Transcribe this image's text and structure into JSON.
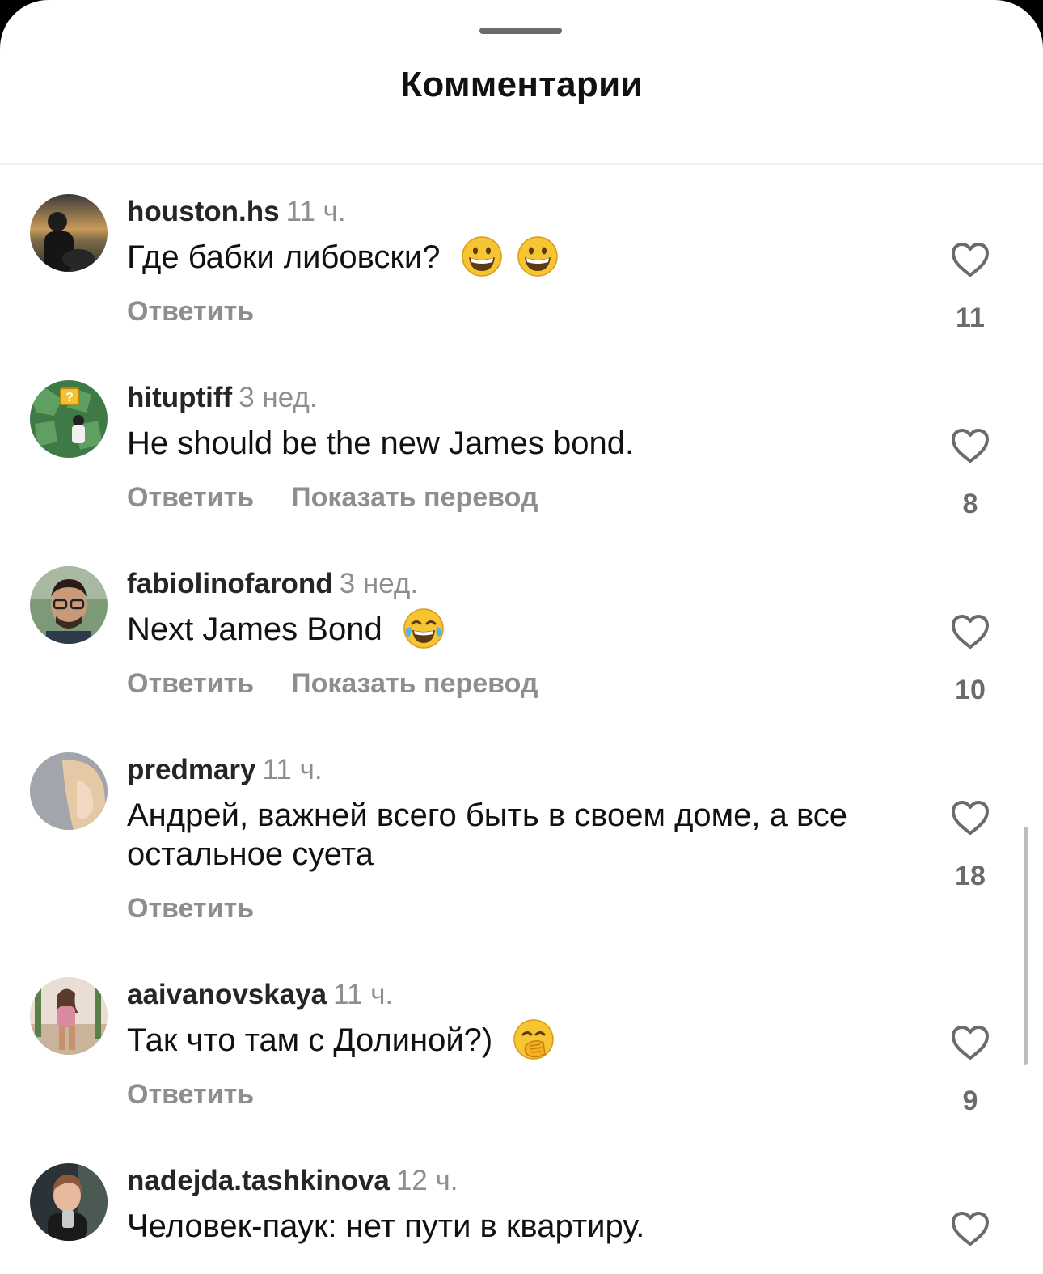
{
  "header": {
    "title": "Комментарии"
  },
  "comments": [
    {
      "username": "houston.hs",
      "time": "11 ч.",
      "text": "Где бабки либовски?",
      "emojis": [
        "grinning-face-emoji",
        "grinning-face-emoji"
      ],
      "reply_label": "Ответить",
      "translate_label": "",
      "like_count": "11"
    },
    {
      "username": "hituptiff",
      "time": "3 нед.",
      "text": "He should be the new James bond.",
      "emojis": [],
      "reply_label": "Ответить",
      "translate_label": "Показать перевод",
      "like_count": "8"
    },
    {
      "username": "fabiolinofarond",
      "time": "3 нед.",
      "text": "Next James Bond",
      "emojis": [
        "tears-of-joy-emoji"
      ],
      "reply_label": "Ответить",
      "translate_label": "Показать перевод",
      "like_count": "10"
    },
    {
      "username": "predmary",
      "time": "11 ч.",
      "text": "Андрей, важней всего быть в своем доме, а все остальное суета",
      "emojis": [],
      "reply_label": "Ответить",
      "translate_label": "",
      "like_count": "18"
    },
    {
      "username": "aaivanovskaya",
      "time": "11 ч.",
      "text": "Так что там с Долиной?)",
      "emojis": [
        "hand-over-mouth-emoji"
      ],
      "reply_label": "Ответить",
      "translate_label": "",
      "like_count": "9"
    },
    {
      "username": "nadejda.tashkinova",
      "time": "12 ч.",
      "text": "Человек-паук: нет пути в квартиру.",
      "emojis": [],
      "reply_label": "",
      "translate_label": "",
      "like_count": ""
    }
  ],
  "icons": {
    "like": "heart-outline-icon"
  },
  "colors": {
    "username": "#262626",
    "secondary_text": "#8e8e8e",
    "like_count": "#6b6b6b"
  }
}
